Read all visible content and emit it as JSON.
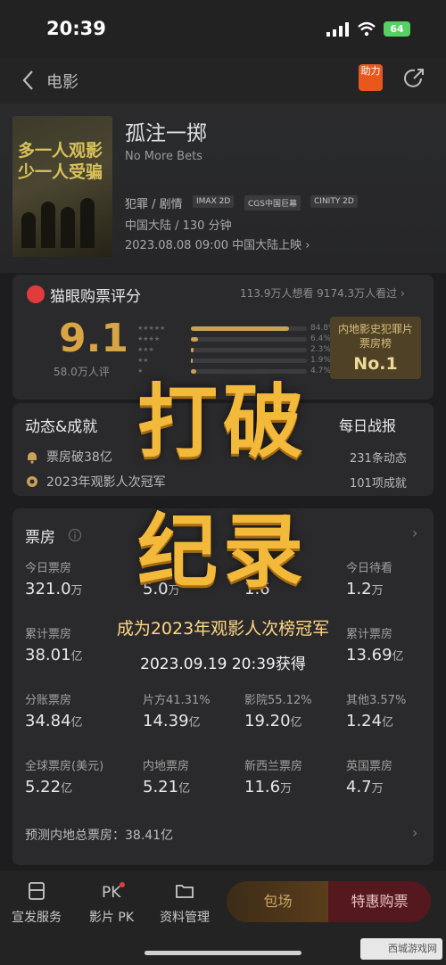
{
  "status_bar": {
    "time": "20:39",
    "battery": "64"
  },
  "nav": {
    "back_label": "电影",
    "boost_label": "助力"
  },
  "poster": {
    "line1": "多一人观影",
    "line2": "少一人受骗"
  },
  "movie": {
    "title": "孤注一掷",
    "title_en": "No More Bets",
    "genre": "犯罪 / 剧情",
    "formats": [
      "IMAX 2D",
      "CGS中国巨幕",
      "CINITY 2D"
    ],
    "region_runtime": "中国大陆 / 130 分钟",
    "release": "2023.08.08 09:00 中国大陆上映 ›"
  },
  "rating": {
    "title": "猫眼购票评分",
    "counts": "113.9万人想看 9174.3万人看过 ›",
    "score": "9.1",
    "score_sub": "58.0万人评",
    "distribution": [
      {
        "stars": "★★★★★",
        "pct": "84.8%",
        "fraction": 0.848
      },
      {
        "stars": "★★★★",
        "pct": "6.4%",
        "fraction": 0.064
      },
      {
        "stars": "★★★",
        "pct": "2.3%",
        "fraction": 0.023
      },
      {
        "stars": "★★",
        "pct": "1.9%",
        "fraction": 0.019
      },
      {
        "stars": "★",
        "pct": "4.7%",
        "fraction": 0.047
      }
    ],
    "rank_line1": "内地影史犯罪片",
    "rank_line2": "票房榜",
    "rank_no": "No.1"
  },
  "news": {
    "title": "动态&成就",
    "daily_report": "每日战报",
    "line1": "票房破38亿",
    "line2": "2023年观影人次冠军",
    "count1": "231条动态",
    "count2": "101项成就"
  },
  "box_office": {
    "title": "票房",
    "rows": [
      [
        {
          "label": "今日票房",
          "value": "321.0",
          "unit": "万"
        },
        {
          "label": "",
          "value": "5.0",
          "unit": "万"
        },
        {
          "label": "",
          "value": "1.6",
          "unit": ""
        },
        {
          "label": "今日待看",
          "value": "1.2",
          "unit": "万"
        }
      ],
      [
        {
          "label": "累计票房",
          "value": "38.01",
          "unit": "亿"
        },
        {
          "label": "",
          "value": "",
          "unit": ""
        },
        {
          "label": "",
          "value": "",
          "unit": ""
        },
        {
          "label": "累计票房",
          "value": "13.69",
          "unit": "亿"
        }
      ],
      [
        {
          "label": "分账票房",
          "value": "34.84",
          "unit": "亿"
        },
        {
          "label": "片方41.31%",
          "value": "14.39",
          "unit": "亿"
        },
        {
          "label": "影院55.12%",
          "value": "19.20",
          "unit": "亿"
        },
        {
          "label": "其他3.57%",
          "value": "1.24",
          "unit": "亿"
        }
      ],
      [
        {
          "label": "全球票房(美元)",
          "value": "5.22",
          "unit": "亿"
        },
        {
          "label": "内地票房",
          "value": "5.21",
          "unit": "亿"
        },
        {
          "label": "新西兰票房",
          "value": "11.6",
          "unit": "万"
        },
        {
          "label": "英国票房",
          "value": "4.7",
          "unit": "万"
        }
      ]
    ],
    "forecast": "预测内地总票房：38.41亿"
  },
  "overlay": {
    "line1": "打破",
    "line2": "纪录",
    "subtitle": "成为2023年观影人次榜冠军",
    "date": "2023.09.19 20:39获得"
  },
  "tabbar": {
    "items": [
      "宣发服务",
      "影片 PK",
      "资料管理"
    ],
    "baochang": "包场",
    "buy": "特惠购票"
  },
  "watermark": "西城游戏网"
}
